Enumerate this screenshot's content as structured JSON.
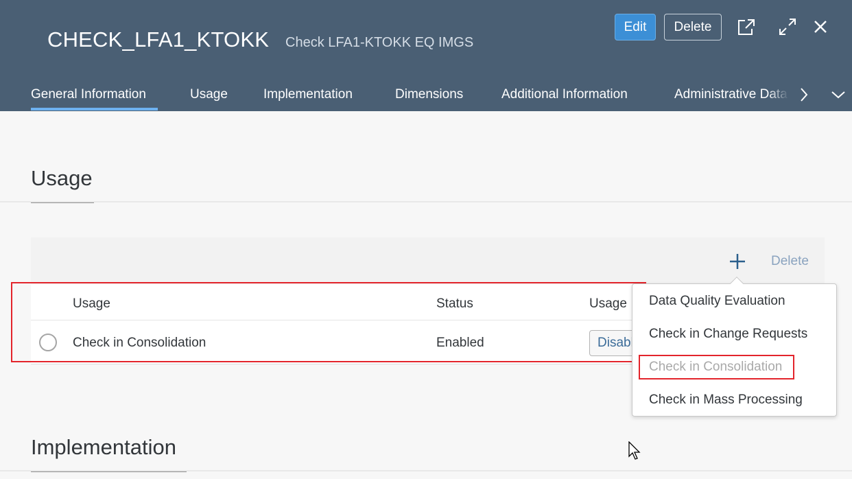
{
  "header": {
    "title": "CHECK_LFA1_KTOKK",
    "subtitle": "Check LFA1-KTOKK EQ IMGS",
    "edit_label": "Edit",
    "delete_label": "Delete",
    "icons": [
      "share-icon",
      "fullscreen-icon",
      "close-icon"
    ]
  },
  "tabs": [
    {
      "label": "General Information",
      "active": true
    },
    {
      "label": "Usage"
    },
    {
      "label": "Implementation"
    },
    {
      "label": "Dimensions"
    },
    {
      "label": "Additional Information"
    },
    {
      "label": "Administrative Data"
    }
  ],
  "usage_section": {
    "title": "Usage",
    "toolbar": {
      "add_icon": "plus-icon",
      "delete_label": "Delete"
    },
    "columns": [
      "Usage",
      "Status",
      "Usage"
    ],
    "rows": [
      {
        "usage": "Check in Consolidation",
        "status": "Enabled",
        "action": "Disable"
      }
    ]
  },
  "popover": {
    "items": [
      {
        "label": "Data Quality Evaluation",
        "enabled": true
      },
      {
        "label": "Check in Change Requests",
        "enabled": true
      },
      {
        "label": "Check in Consolidation",
        "enabled": false
      },
      {
        "label": "Check in Mass Processing",
        "enabled": true
      }
    ]
  },
  "implementation_section": {
    "title": "Implementation"
  },
  "colors": {
    "header_bg": "#4a5f74",
    "accent": "#3c8fd6",
    "highlight": "#e3242b"
  }
}
